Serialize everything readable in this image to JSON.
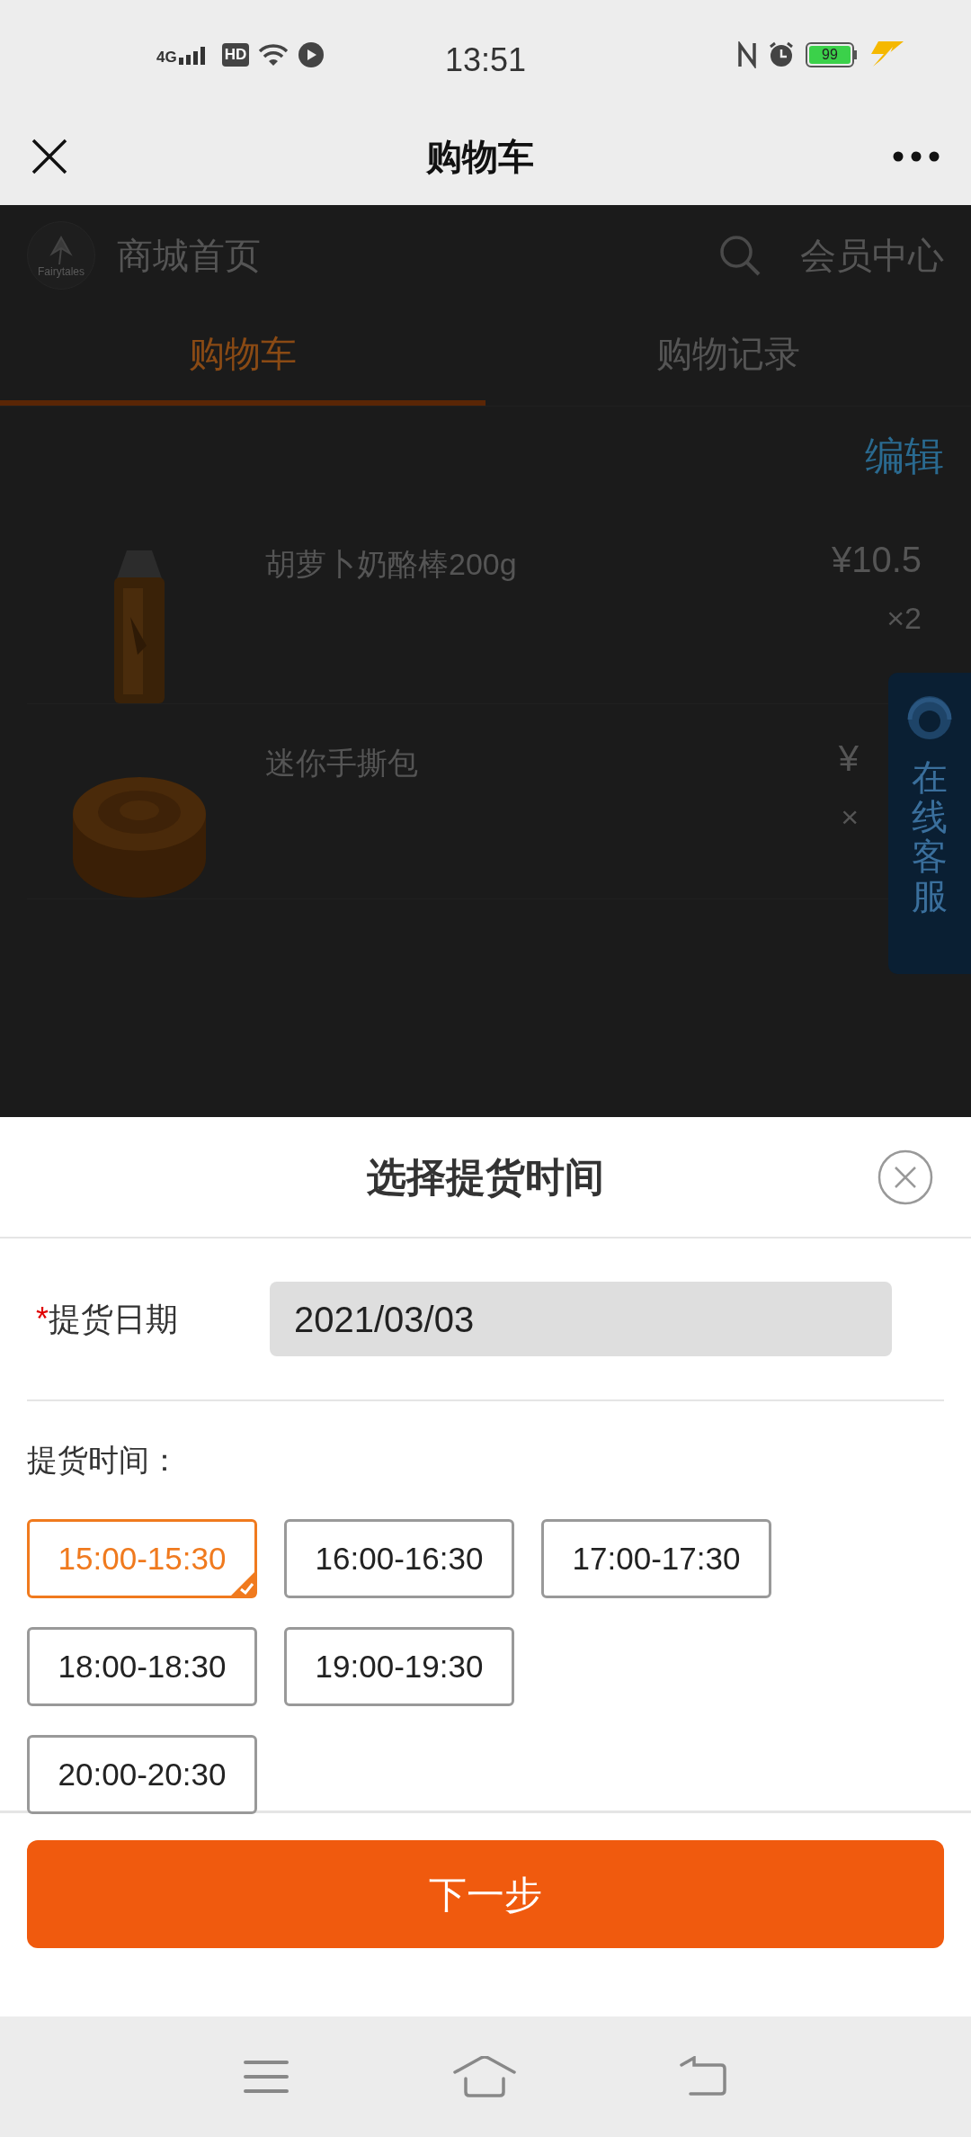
{
  "status_bar": {
    "network": "4G",
    "hd": "HD",
    "time": "13:51",
    "battery": "99"
  },
  "nav": {
    "title": "购物车"
  },
  "background_page": {
    "logo_text": "Fairytales",
    "home_link": "商城首页",
    "member_link": "会员中心",
    "tabs": [
      {
        "label": "购物车",
        "selected": true
      },
      {
        "label": "购物记录",
        "selected": false
      }
    ],
    "edit": "编辑",
    "products": [
      {
        "name": "胡萝卜奶酪棒200g",
        "price": "¥10.5",
        "quantity": "×2",
        "kind": "bag"
      },
      {
        "name": "迷你手撕包",
        "price": "¥",
        "quantity": "×",
        "kind": "bun"
      }
    ],
    "service": "在线客服"
  },
  "sheet": {
    "title": "选择提货时间",
    "required_mark": "*",
    "date_label": "提货日期",
    "date_value": "2021/03/03",
    "time_label": "提货时间：",
    "slot_rows": [
      [
        {
          "label": "15:00-15:30",
          "selected": true
        },
        {
          "label": "16:00-16:30",
          "selected": false
        },
        {
          "label": "17:00-17:30",
          "selected": false
        }
      ],
      [
        {
          "label": "18:00-18:30",
          "selected": false
        },
        {
          "label": "19:00-19:30",
          "selected": false
        }
      ],
      [
        {
          "label": "20:00-20:30",
          "selected": false
        }
      ]
    ],
    "next_button": "下一步"
  }
}
